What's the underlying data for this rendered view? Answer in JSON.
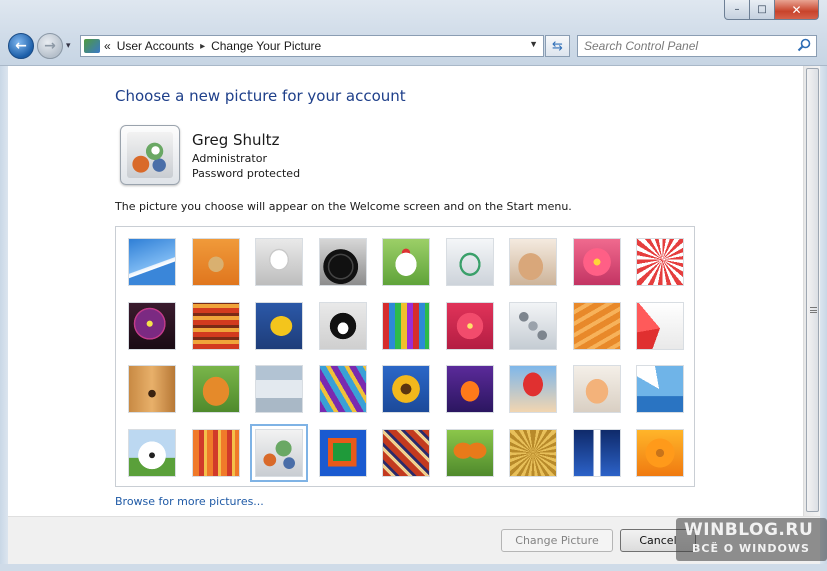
{
  "window": {
    "minimize_glyph": "–",
    "maximize_glyph": "□",
    "close_glyph": "✕"
  },
  "navigation": {
    "back_glyph": "←",
    "forward_glyph": "→",
    "recent_glyph": "▾"
  },
  "address_bar": {
    "overflow_glyph": "«",
    "separator_glyph": "▸",
    "crumbs": [
      "User Accounts",
      "Change Your Picture"
    ],
    "dropdown_glyph": "▼",
    "refresh_glyph": "⇆"
  },
  "search": {
    "placeholder": "Search Control Panel"
  },
  "page": {
    "heading": "Choose a new picture for your account",
    "description": "The picture you choose will appear on the Welcome screen and on the Start menu.",
    "browse_link": "Browse for more pictures..."
  },
  "user": {
    "name": "Greg Shultz",
    "role": "Administrator",
    "password_status": "Password protected"
  },
  "pictures": {
    "selected_index": 29,
    "items": [
      "roller-coaster",
      "starfish",
      "robot-toy",
      "turntable",
      "lucky-cat",
      "gyroscope",
      "kitten",
      "pink-flower",
      "ferris-wheel",
      "ball",
      "fabric",
      "leaf",
      "dog",
      "crayons",
      "star",
      "jacks",
      "stairs",
      "paper-crane",
      "guitar",
      "pomeranian",
      "tin-robot",
      "sari",
      "sunflower",
      "clownfish",
      "hot-air-balloon",
      "bird-toy",
      "sailboat",
      "soccer-ball",
      "fabric-stripes",
      "marbles",
      "window",
      "rug",
      "butterfly",
      "weave",
      "lighthouse",
      "daisy"
    ]
  },
  "buttons": {
    "change_picture": "Change Picture",
    "cancel": "Cancel"
  },
  "watermark": {
    "line1": "WINBLOG.RU",
    "line2": "ВСЁ О WINDOWS"
  },
  "colors": {
    "heading": "#1e3f8a",
    "link": "#1f5aa6",
    "selection": "#4b8fd4"
  }
}
